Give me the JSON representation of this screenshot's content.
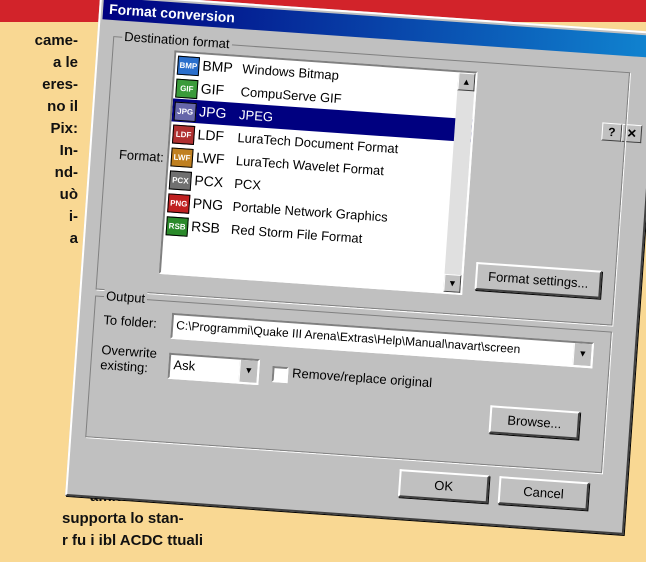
{
  "article": {
    "lines": [
      "came-",
      "a   le",
      "eres-",
      "no   il",
      "Pix:",
      "In-",
      "nd-",
      "uò",
      "i-",
      "a"
    ],
    "bottom_lines": [
      "amite",
      "supporta lo stan-",
      "r fu    i      ibl       ACDC          ttuali"
    ]
  },
  "dialog": {
    "title": "Format conversion",
    "help_button": "?",
    "close_button": "✕",
    "destination_group": "Destination format",
    "format_label": "Format:",
    "formats": [
      {
        "ext": "BMP",
        "desc": "Windows Bitmap",
        "icon": "bmp-icon",
        "color": "#2a6fcc"
      },
      {
        "ext": "GIF",
        "desc": "CompuServe GIF",
        "icon": "gif-icon",
        "color": "#3a9b3a"
      },
      {
        "ext": "JPG",
        "desc": "JPEG",
        "icon": "jpg-icon",
        "color": "#6666aa"
      },
      {
        "ext": "LDF",
        "desc": "LuraTech Document Format",
        "icon": "ldf-icon",
        "color": "#b03030"
      },
      {
        "ext": "LWF",
        "desc": "LuraTech Wavelet Format",
        "icon": "lwf-icon",
        "color": "#c08020"
      },
      {
        "ext": "PCX",
        "desc": "PCX",
        "icon": "pcx-icon",
        "color": "#707070"
      },
      {
        "ext": "PNG",
        "desc": "Portable Network Graphics",
        "icon": "png-icon",
        "color": "#c02020"
      },
      {
        "ext": "RSB",
        "desc": "Red Storm File Format",
        "icon": "rsb-icon",
        "color": "#2a8a2a"
      }
    ],
    "selected_index": 2,
    "format_settings_button": "Format settings...",
    "output_group": "Output",
    "to_folder_label": "To folder:",
    "to_folder_value": "C:\\Programmi\\Quake III Arena\\Extras\\Help\\Manual\\navart\\screen",
    "overwrite_label_1": "Overwrite",
    "overwrite_label_2": "existing:",
    "overwrite_value": "Ask",
    "remove_replace_label": "Remove/replace original",
    "browse_button": "Browse...",
    "ok_button": "OK",
    "cancel_button": "Cancel"
  },
  "colors": {
    "page_background": "#f9d893",
    "top_bar": "#d2232a",
    "title_bar": "#000080",
    "dialog_face": "#c0c0c0"
  }
}
